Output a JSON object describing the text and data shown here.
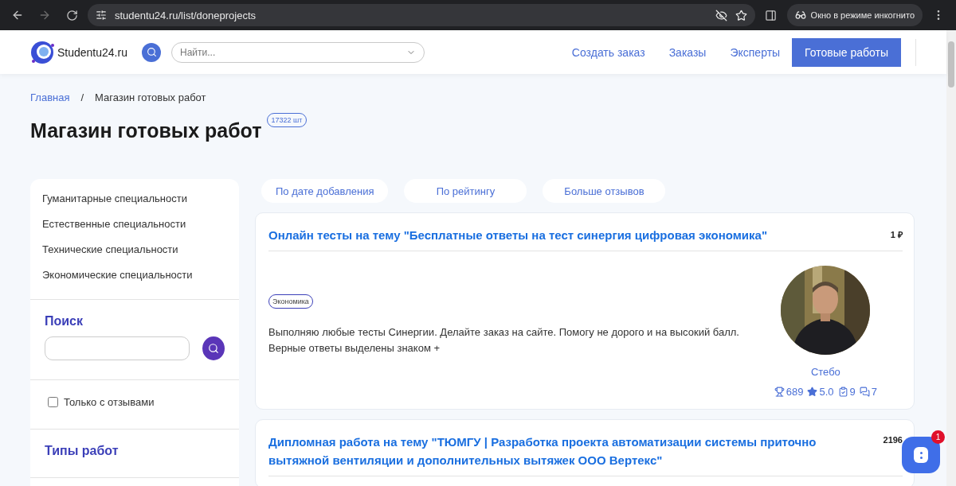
{
  "browser": {
    "url": "studentu24.ru/list/doneprojects",
    "incognito": "Окно в режиме инкогнито"
  },
  "header": {
    "logo": "Studentu24.ru",
    "search_placeholder": "Найти...",
    "nav": [
      {
        "label": "Создать заказ",
        "selected": false
      },
      {
        "label": "Заказы",
        "selected": false
      },
      {
        "label": "Эксперты",
        "selected": false
      },
      {
        "label": "Готовые работы",
        "selected": true
      }
    ]
  },
  "breadcrumbs": [
    "Главная",
    "Магазин готовых работ"
  ],
  "breadcrumb_separator": "/",
  "page_title": "Магазин готовых работ",
  "count_badge": "17322 шт",
  "sidebar": {
    "categories": [
      "Гуманитарные специальности",
      "Естественные специальности",
      "Технические специальности",
      "Экономические специальности"
    ],
    "search_title": "Поиск",
    "reviews_only": {
      "label": "Только с отзывами",
      "checked": false
    },
    "types_title": "Типы работ"
  },
  "sort_buttons": [
    "По дате добавления",
    "По рейтингу",
    "Больше отзывов"
  ],
  "works": [
    {
      "title": "Онлайн тесты на тему \"Бесплатные ответы на тест синергия цифровая экономика\"",
      "price": "1 ₽",
      "tag": "Экономика",
      "description": [
        "Выполняю любые тесты Синергии. Делайте заказ на сайте. Помогу не дорого и на высокий балл.",
        "Верные ответы выделены знаком +"
      ],
      "author": {
        "name": "Стебо",
        "trophies": "689",
        "rating": "5.0",
        "done": "9",
        "reviews": "7"
      }
    },
    {
      "title": "Дипломная работа на тему \"ТЮМГУ | Разработка проекта автоматизации системы приточно вытяжной вентиляции и дополнительных вытяжек ООО Вертекс\"",
      "price": "2196"
    }
  ],
  "chat": {
    "unread": "1"
  }
}
